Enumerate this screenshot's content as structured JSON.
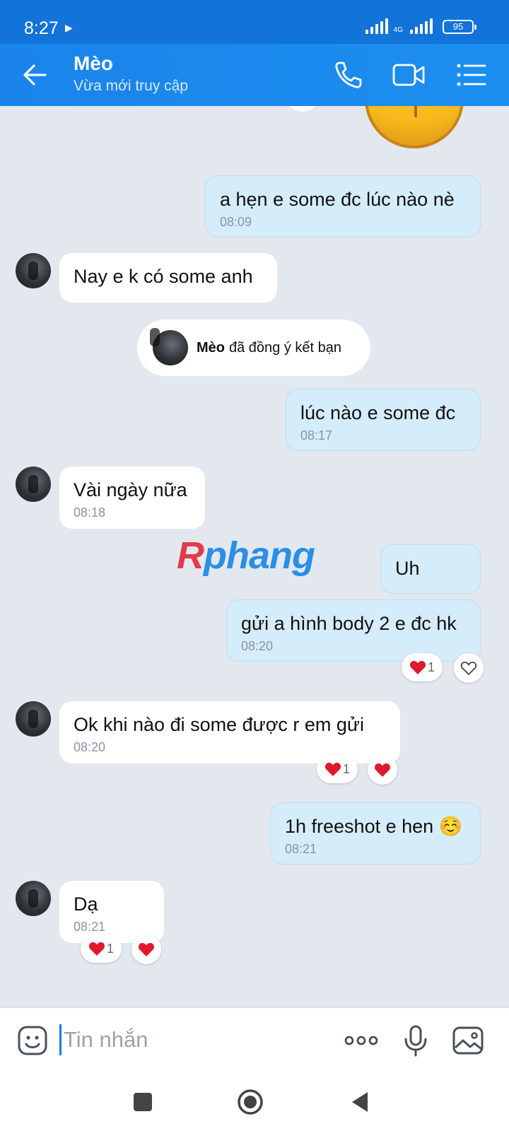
{
  "status": {
    "time": "8:27",
    "battery": "95",
    "network": "4G"
  },
  "header": {
    "name": "Mèo",
    "status": "Vừa mới truy cập"
  },
  "system_message": {
    "name": "Mèo",
    "text": "đã đồng ý kết bạn"
  },
  "watermark": {
    "left": "R",
    "right": "phang"
  },
  "messages": [
    {
      "from": "me",
      "text": "a hẹn e some đc lúc nào nè",
      "time": "08:09"
    },
    {
      "from": "them",
      "text": "Nay e k có some anh"
    },
    {
      "from": "me",
      "text": "lúc nào e some đc",
      "time": "08:17"
    },
    {
      "from": "them",
      "text": "Vài ngày nữa",
      "time": "08:18"
    },
    {
      "from": "me",
      "text": "Uh"
    },
    {
      "from": "me",
      "text": "gửi a hình body 2 e đc hk",
      "time": "08:20",
      "reaction_count": "1"
    },
    {
      "from": "them",
      "text": "Ok khi nào đi some được r em gửi",
      "time": "08:20",
      "reaction_count": "1"
    },
    {
      "from": "me",
      "text": "1h freeshot e hen ☺️",
      "time": "08:21"
    },
    {
      "from": "them",
      "text": "Dạ",
      "time": "08:21",
      "reaction_count": "1"
    }
  ],
  "input": {
    "placeholder": "Tin nhắn"
  },
  "icons": {
    "header": [
      "back-arrow-icon",
      "phone-icon",
      "video-call-icon",
      "menu-list-icon"
    ],
    "input": [
      "sticker-icon",
      "more-icon",
      "microphone-icon",
      "image-icon"
    ],
    "nav": [
      "recent-apps-icon",
      "home-icon",
      "back-icon"
    ]
  },
  "colors": {
    "header": "#1a84ea",
    "my_bubble": "#d5ecfb",
    "their_bubble": "#ffffff",
    "background": "#e3e8ee",
    "heart": "#e0192d"
  }
}
